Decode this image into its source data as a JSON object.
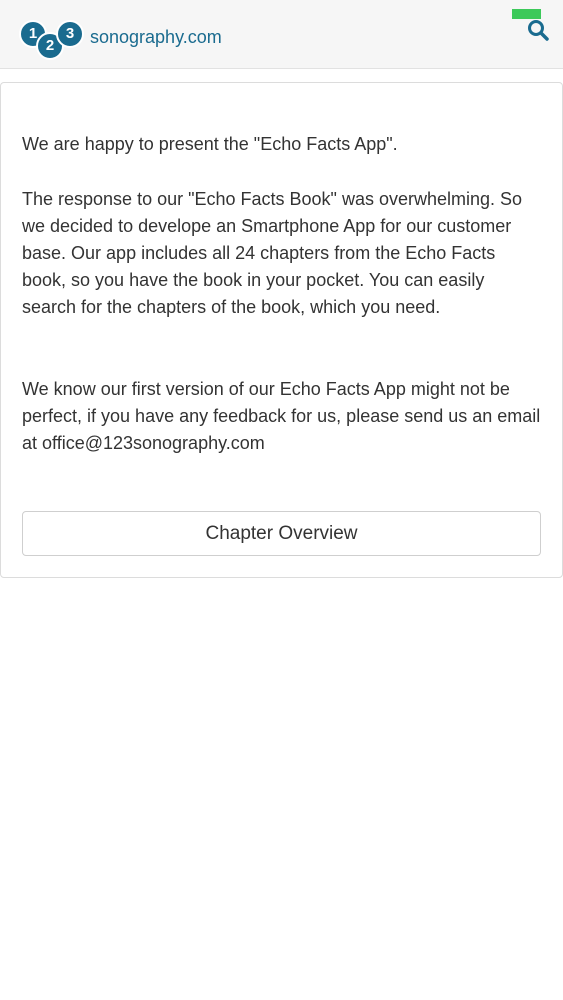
{
  "header": {
    "logo": {
      "digits": [
        "1",
        "2",
        "3"
      ],
      "text": "sonography.com",
      "color": "#1a6b8f"
    },
    "search_icon": "search-icon",
    "status_color": "#3cc95a"
  },
  "main": {
    "paragraphs": [
      "We are happy to present the \"Echo Facts App\".",
      "The response to our \"Echo Facts Book\" was overwhelming. So we decided to develope an Smartphone App for our customer base. Our app includes all 24 chapters from the Echo Facts book, so you have the book in your pocket. You can easily search for the chapters of the book, which you need.",
      "We know our first version of our Echo Facts App might not be perfect, if you have any feedback for us, please send us an email at office@123sonography.com"
    ],
    "chapter_button_label": "Chapter Overview"
  }
}
